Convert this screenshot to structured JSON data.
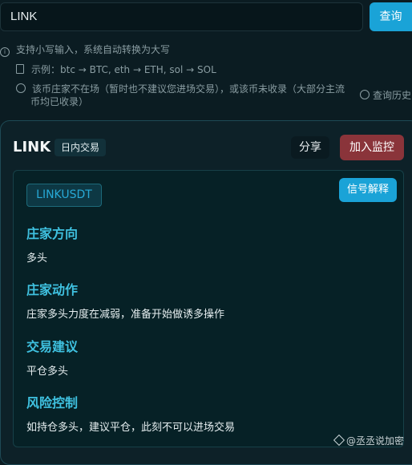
{
  "search": {
    "value": "LINK",
    "button_label": "查询"
  },
  "hints": {
    "line1": "支持小写输入，系统自动转换为大写",
    "line2": "示例：btc → BTC, eth → ETH, sol → SOL",
    "line3a": "该币庄家不在场（暂时也不建议您进场交易），或该币未收录（大部分主流",
    "line3b": "币均已收录）",
    "history": "查询历史"
  },
  "card": {
    "title": "LINK",
    "badge": "日内交易",
    "share_label": "分享",
    "monitor_label": "加入监控",
    "symbol": "LINKUSDT",
    "signal_label": "信号解释",
    "sections": [
      {
        "title": "庄家方向",
        "body": "多头"
      },
      {
        "title": "庄家动作",
        "body": "庄家多头力度在减弱，准备开始做诱多操作"
      },
      {
        "title": "交易建议",
        "body": "平仓多头"
      },
      {
        "title": "风险控制",
        "body": "如持仓多头，建议平仓，此刻不可以进场交易"
      }
    ]
  },
  "watermark": "@丞丞说加密",
  "colors": {
    "accent": "#1aa3d7",
    "danger": "#8a343a",
    "section_title": "#3fc1e0",
    "background": "#0b1c22"
  }
}
